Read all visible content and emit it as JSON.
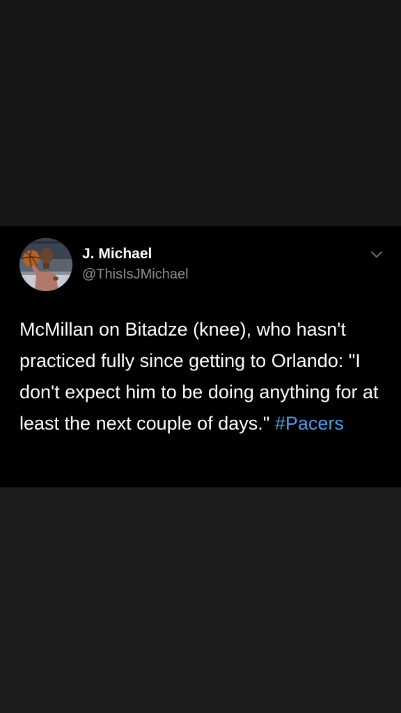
{
  "tweet": {
    "author_name": "J. Michael",
    "author_handle": "@ThisIsJMichael",
    "text": "McMillan on Bitadze (knee), who hasn't practiced fully since getting to Orlando: \"I don't expect him to be doing anything for at least the next couple of days.\"",
    "hashtag": "#Pacers"
  },
  "icons": {
    "avatar": "profile-photo-man-holding-basketball",
    "menu": "chevron-down-icon"
  },
  "colors": {
    "card_background": "#000000",
    "page_background": "#1b1b1b",
    "text": "#ffffff",
    "secondary_text": "#8e8e93",
    "hashtag": "#4a9ee8"
  }
}
